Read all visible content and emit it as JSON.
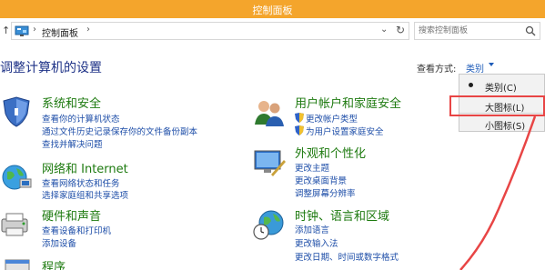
{
  "window": {
    "title": "控制面板"
  },
  "address": {
    "path": "控制面板"
  },
  "search": {
    "placeholder": "搜索控制面板"
  },
  "heading": "调整计算机的设置",
  "view_by": {
    "label": "查看方式:",
    "value": "类别"
  },
  "menu": {
    "items": [
      {
        "label": "类别(C)",
        "selected": true
      },
      {
        "label": "大图标(L)",
        "selected": false
      },
      {
        "label": "小图标(S)",
        "selected": false
      }
    ]
  },
  "categories": [
    {
      "title": "系统和安全",
      "icon": "system-security-icon",
      "links": [
        {
          "label": "查看你的计算机状态"
        },
        {
          "label": "通过文件历史记录保存你的文件备份副本"
        },
        {
          "label": "查找并解决问题"
        }
      ]
    },
    {
      "title": "网络和 Internet",
      "icon": "network-icon",
      "links": [
        {
          "label": "查看网络状态和任务"
        },
        {
          "label": "选择家庭组和共享选项"
        }
      ]
    },
    {
      "title": "硬件和声音",
      "icon": "hardware-sound-icon",
      "links": [
        {
          "label": "查看设备和打印机"
        },
        {
          "label": "添加设备"
        }
      ]
    },
    {
      "title": "程序",
      "icon": "programs-icon",
      "links": []
    },
    {
      "title": "用户帐户和家庭安全",
      "icon": "users-icon",
      "links": [
        {
          "label": "更改帐户类型",
          "shield": true
        },
        {
          "label": "为用户设置家庭安全",
          "shield": true
        }
      ]
    },
    {
      "title": "外观和个性化",
      "icon": "appearance-icon",
      "links": [
        {
          "label": "更改主题"
        },
        {
          "label": "更改桌面背景"
        },
        {
          "label": "调整屏幕分辨率"
        }
      ]
    },
    {
      "title": "时钟、语言和区域",
      "icon": "clock-globe-icon",
      "links": [
        {
          "label": "添加语言"
        },
        {
          "label": "更改输入法"
        },
        {
          "label": "更改日期、时间或数字格式"
        }
      ]
    }
  ],
  "colors": {
    "titlebar": "#f4a52c",
    "category_title": "#1d7a0f",
    "link": "#1e4ea8",
    "heading": "#1e3287",
    "annotation": "#e84545"
  }
}
